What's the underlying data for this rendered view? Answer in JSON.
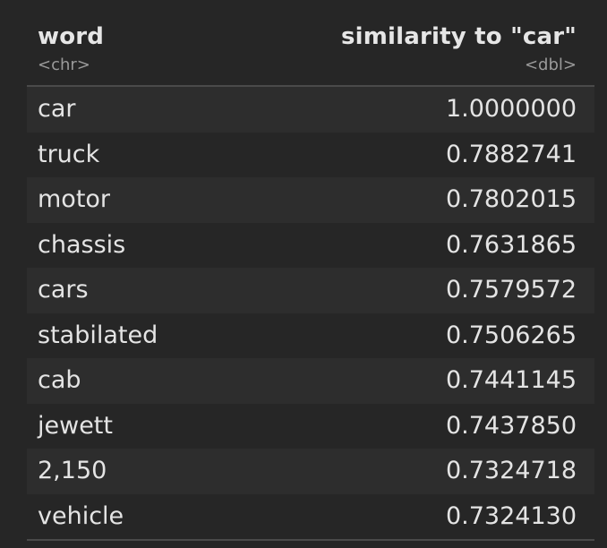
{
  "table": {
    "columns": [
      {
        "name": "word",
        "type": "<chr>"
      },
      {
        "name": "similarity to \"car\"",
        "type": "<dbl>"
      }
    ],
    "rows": [
      {
        "word": "car",
        "similarity": "1.0000000"
      },
      {
        "word": "truck",
        "similarity": "0.7882741"
      },
      {
        "word": "motor",
        "similarity": "0.7802015"
      },
      {
        "word": "chassis",
        "similarity": "0.7631865"
      },
      {
        "word": "cars",
        "similarity": "0.7579572"
      },
      {
        "word": "stabilated",
        "similarity": "0.7506265"
      },
      {
        "word": "cab",
        "similarity": "0.7441145"
      },
      {
        "word": "jewett",
        "similarity": "0.7437850"
      },
      {
        "word": "2,150",
        "similarity": "0.7324718"
      },
      {
        "word": "vehicle",
        "similarity": "0.7324130"
      }
    ]
  }
}
